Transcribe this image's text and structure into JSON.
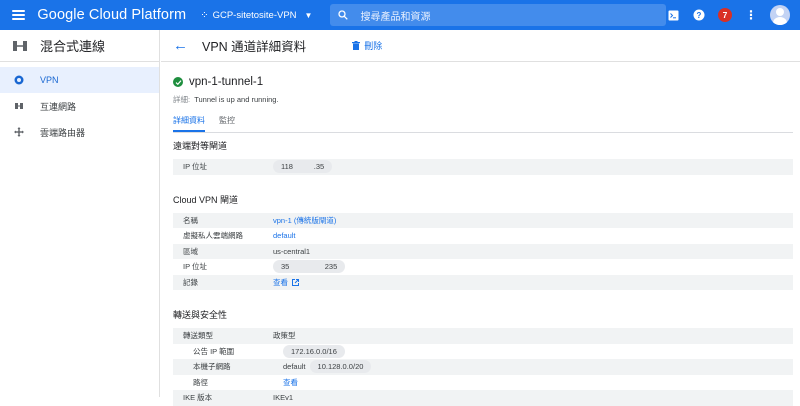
{
  "topbar": {
    "brand": "Google Cloud Platform",
    "project": "GCP-sitetosite-VPN",
    "search_placeholder": "搜尋產品和資源",
    "notification_count": "7"
  },
  "sidebar": {
    "title": "混合式連線",
    "items": [
      {
        "label": "VPN",
        "icon": "vpn-icon",
        "active": true
      },
      {
        "label": "互連網路",
        "icon": "interconnect-icon",
        "active": false
      },
      {
        "label": "雲端路由器",
        "icon": "router-icon",
        "active": false
      }
    ]
  },
  "main": {
    "title": "VPN 通道詳細資料",
    "delete_label": "刪除",
    "tunnel_name": "vpn-1-tunnel-1",
    "status_label": "詳細:",
    "status_text": "Tunnel is up and running.",
    "tabs": [
      {
        "label": "詳細資料",
        "active": true
      },
      {
        "label": "監控",
        "active": false
      }
    ]
  },
  "remote_peer": {
    "title": "遠端對等閘道",
    "ip_label": "IP 位址",
    "ip_value": "118          .35"
  },
  "cloud_vpn": {
    "title": "Cloud VPN 閘道",
    "name_label": "名稱",
    "name_value": "vpn-1 (傳統版閘道)",
    "network_label": "虛擬私人雲端網路",
    "network_value": "default",
    "region_label": "區域",
    "region_value": "us-central1",
    "ip_label": "IP 位址",
    "ip_value": "35                 235",
    "logs_label": "記錄",
    "logs_value": "查看"
  },
  "routing": {
    "title": "轉送與安全性",
    "type_label": "轉送類型",
    "type_value": "政策型",
    "remote_range_label": "公告 IP 範圍",
    "remote_range_value": "172.16.0.0/16",
    "local_subnet_label": "本機子網路",
    "local_subnet_network": "default",
    "local_subnet_value": "10.128.0.0/20",
    "routes_label": "路徑",
    "routes_value": "查看",
    "ike_label": "IKE 版本",
    "ike_value": "IKEv1"
  },
  "colors": {
    "accent": "#1a73e8",
    "success": "#1e8e3e",
    "badge": "#d93025"
  }
}
